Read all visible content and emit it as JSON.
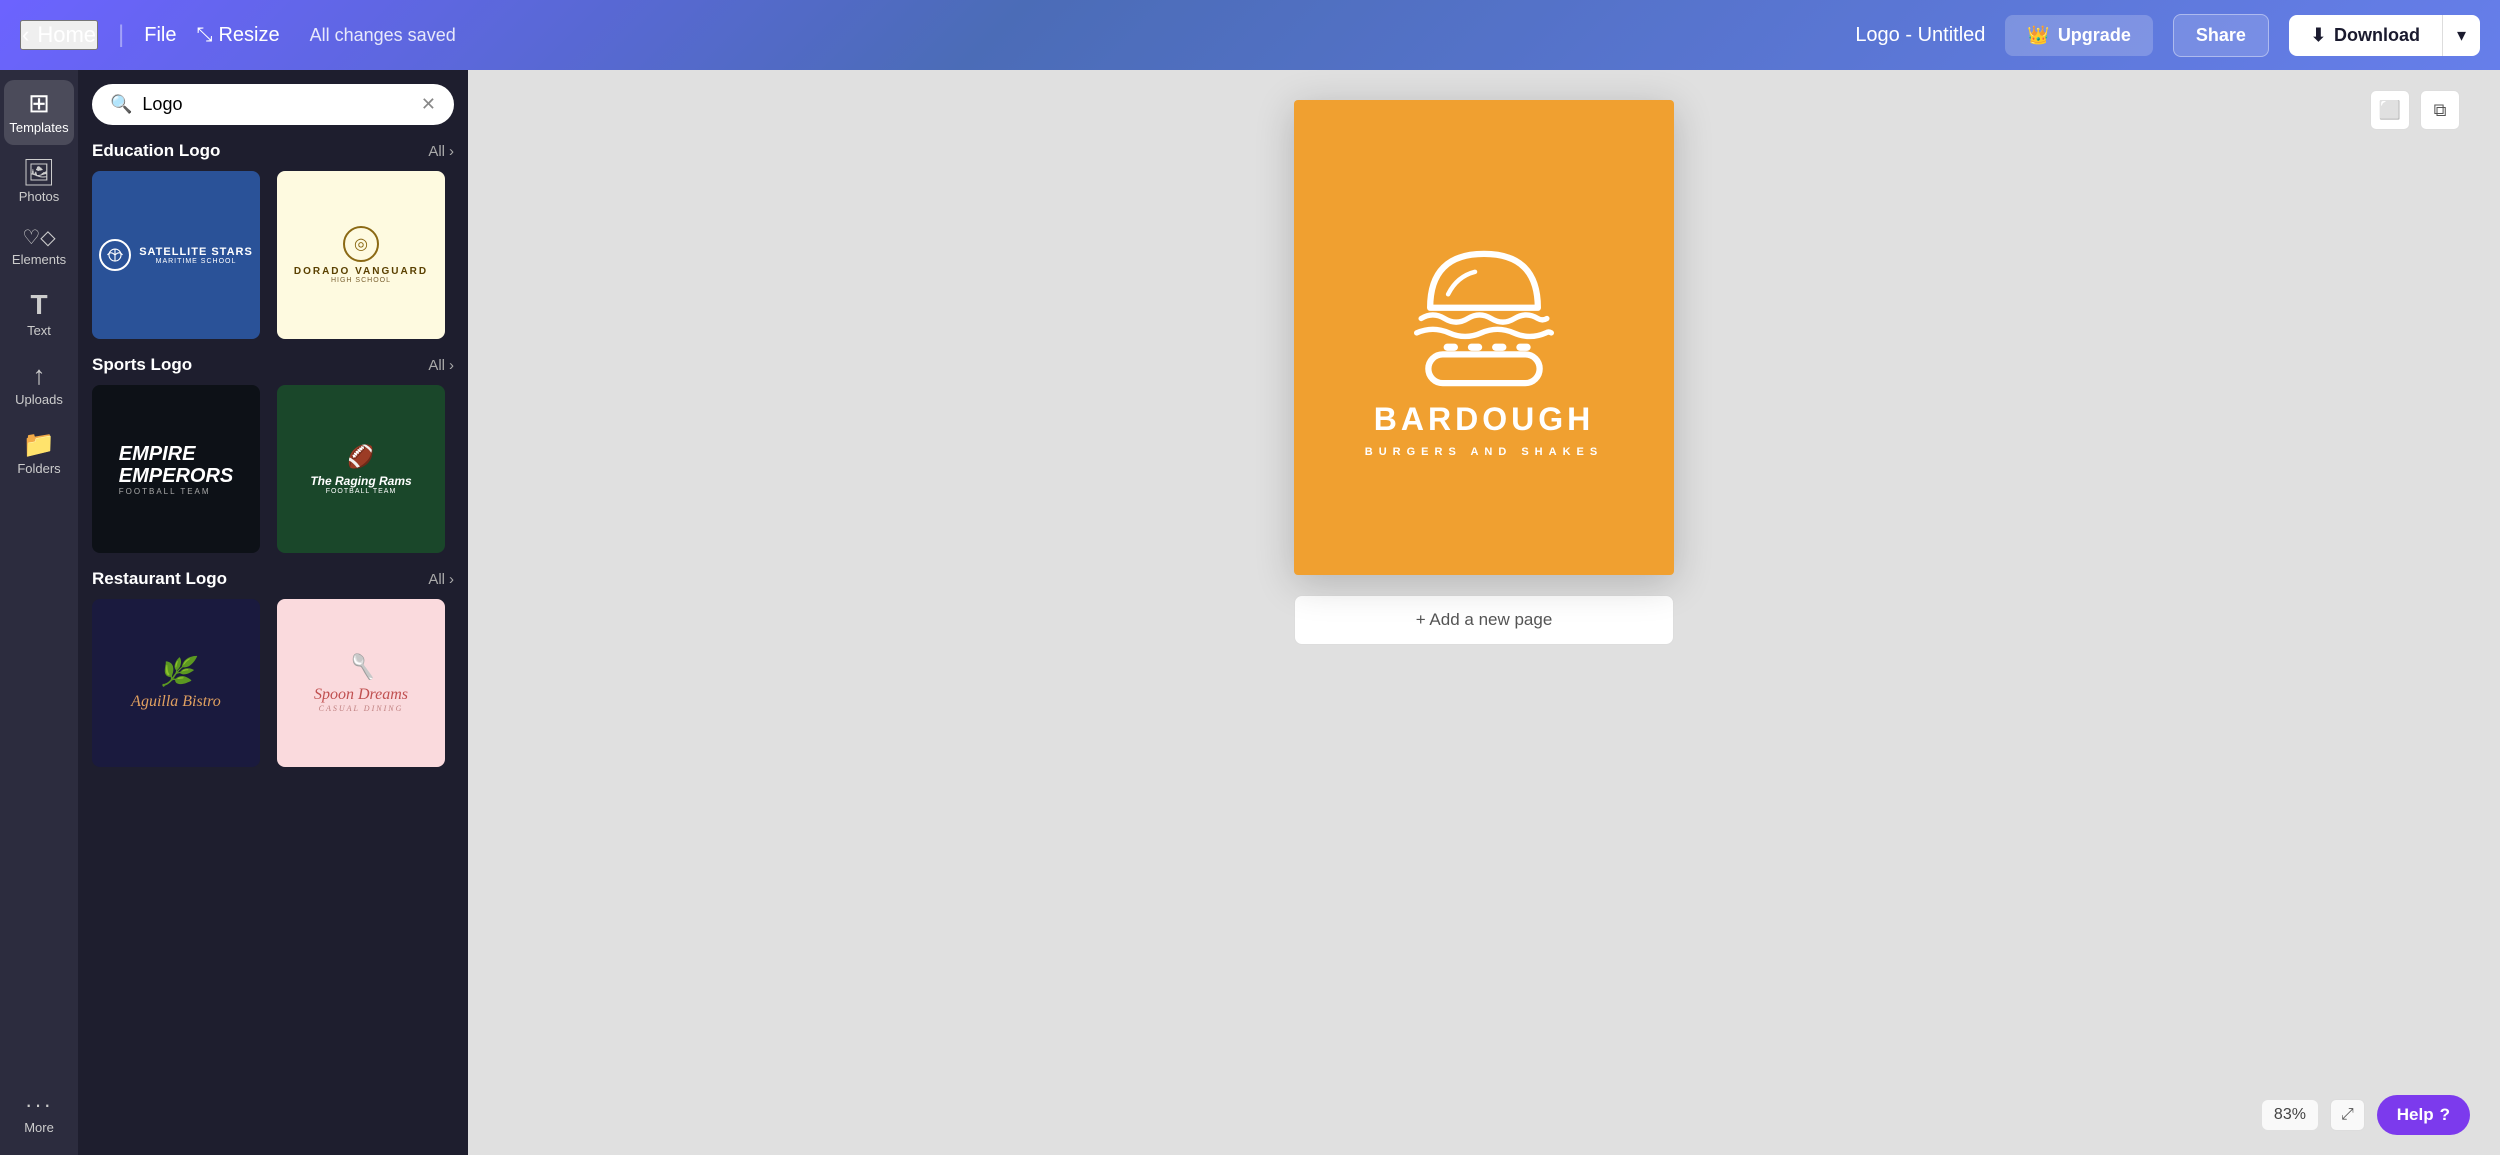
{
  "topNav": {
    "homeLabel": "Home",
    "fileLabel": "File",
    "resizeLabel": "Resize",
    "statusText": "All changes saved",
    "documentTitle": "Logo - Untitled",
    "upgradeLabel": "Upgrade",
    "shareLabel": "Share",
    "downloadLabel": "Download"
  },
  "sidebar": {
    "items": [
      {
        "id": "templates",
        "label": "Templates",
        "icon": "⊞",
        "active": true
      },
      {
        "id": "photos",
        "label": "Photos",
        "icon": "🖼"
      },
      {
        "id": "elements",
        "label": "Elements",
        "icon": "♡◇"
      },
      {
        "id": "text",
        "label": "Text",
        "icon": "T"
      },
      {
        "id": "uploads",
        "label": "Uploads",
        "icon": "↑"
      },
      {
        "id": "folders",
        "label": "Folders",
        "icon": "📁"
      },
      {
        "id": "more",
        "label": "More",
        "icon": "···"
      }
    ]
  },
  "templatesPanel": {
    "searchValue": "Logo",
    "sections": [
      {
        "id": "education",
        "title": "Education Logo",
        "allLabel": "All",
        "cards": [
          {
            "id": "edu1",
            "style": "blue",
            "name": "Satellite Stars"
          },
          {
            "id": "edu2",
            "style": "cream",
            "name": "Dorado Vanguard"
          }
        ]
      },
      {
        "id": "sports",
        "title": "Sports Logo",
        "allLabel": "All",
        "cards": [
          {
            "id": "sports1",
            "style": "dark",
            "name": "Empire Emperors"
          },
          {
            "id": "sports2",
            "style": "green",
            "name": "The Raging Rams"
          }
        ]
      },
      {
        "id": "restaurant",
        "title": "Restaurant Logo",
        "allLabel": "All",
        "cards": [
          {
            "id": "rest1",
            "style": "navy",
            "name": "Aguilla Bistro"
          },
          {
            "id": "rest2",
            "style": "peach",
            "name": "Spoon Dreams"
          }
        ]
      }
    ]
  },
  "canvas": {
    "design": {
      "brandName": "BARDOUGH",
      "brandSub": "BURGERS AND SHAKES",
      "bgColor": "#f0a030"
    },
    "addPageLabel": "+ Add a new page",
    "zoomLevel": "83%",
    "helpLabel": "Help"
  }
}
